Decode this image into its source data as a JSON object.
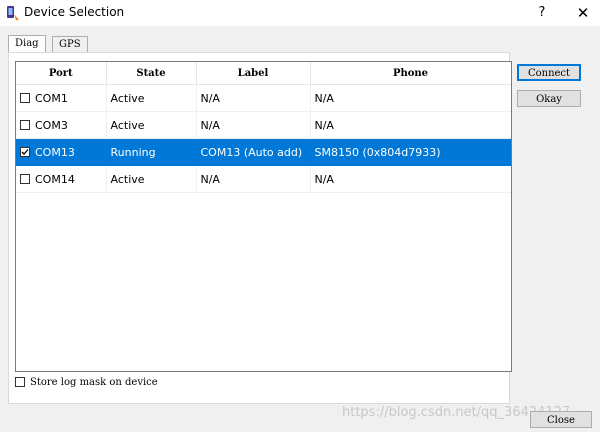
{
  "window": {
    "title": "Device Selection",
    "help": "?",
    "close": "✕"
  },
  "tabs": [
    {
      "label": "Diag",
      "active": true
    },
    {
      "label": "GPS",
      "active": false
    }
  ],
  "table": {
    "columns": [
      "Port",
      "State",
      "Label",
      "Phone"
    ],
    "rows": [
      {
        "checked": false,
        "port": "COM1",
        "state": "Active",
        "label": "N/A",
        "phone": "N/A",
        "selected": false
      },
      {
        "checked": false,
        "port": "COM3",
        "state": "Active",
        "label": "N/A",
        "phone": "N/A",
        "selected": false
      },
      {
        "checked": true,
        "port": "COM13",
        "state": "Running",
        "label": "COM13 (Auto add)",
        "phone": "SM8150 (0x804d7933)",
        "selected": true
      },
      {
        "checked": false,
        "port": "COM14",
        "state": "Active",
        "label": "N/A",
        "phone": "N/A",
        "selected": false
      }
    ]
  },
  "buttons": {
    "connect": "Connect",
    "okay": "Okay",
    "close": "Close"
  },
  "store_log_mask": {
    "label": "Store log mask on device",
    "checked": false
  },
  "watermark": "https://blog.csdn.net/qq_36424127",
  "colors": {
    "selection": "#0078d7",
    "background": "#f0f0f0"
  }
}
